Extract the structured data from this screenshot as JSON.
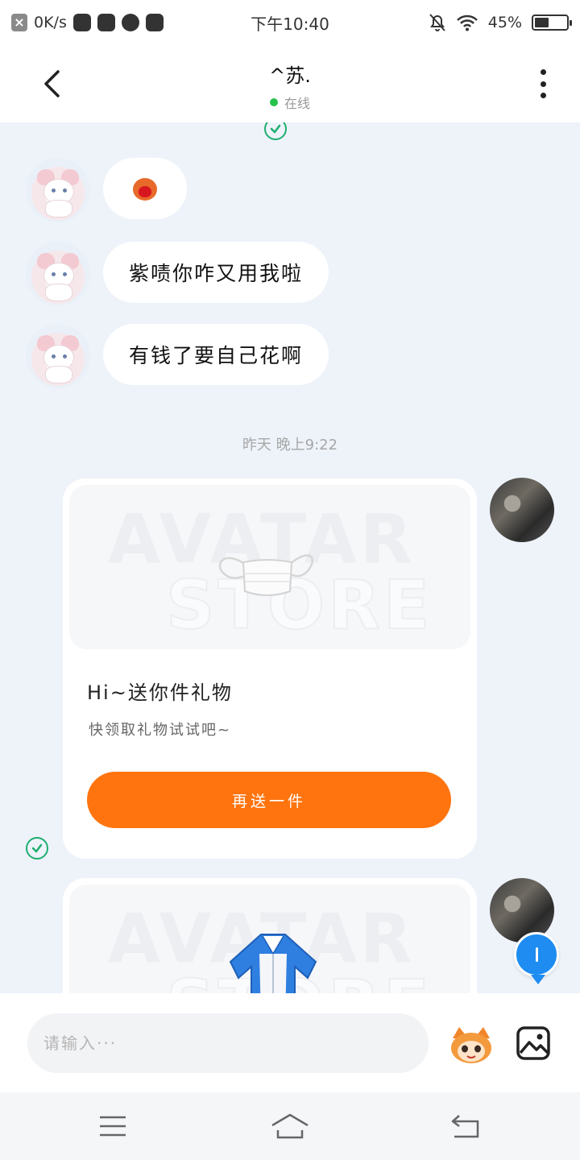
{
  "status_bar": {
    "network_speed": "0K/s",
    "time": "下午10:40",
    "battery_percent": "45%",
    "battery_level": 0.45
  },
  "header": {
    "contact_name": "^苏.",
    "contact_status": "在线",
    "status_color": "#27c24c"
  },
  "messages": [
    {
      "type": "sticker",
      "sender": "contact",
      "icon": "heart-sticker-icon"
    },
    {
      "type": "text",
      "sender": "contact",
      "text": "紫啧你咋又用我啦"
    },
    {
      "type": "text",
      "sender": "contact",
      "text": "有钱了要自己花啊"
    }
  ],
  "time_divider": "昨天 晚上9:22",
  "gift_card": {
    "watermark_line1": "AVATAR",
    "watermark_line2": "STORE",
    "item_icon": "face-mask-icon",
    "title": "Hi~送你件礼物",
    "subtitle": "快领取礼物试试吧~",
    "button_label": "再送一件",
    "button_color": "#ff740e"
  },
  "gift_card_2": {
    "watermark_line1": "AVATAR",
    "watermark_line2": "STORE",
    "item_icon": "jacket-icon"
  },
  "input_bar": {
    "placeholder": "请输入···"
  },
  "colors": {
    "chat_background": "#eef3fa",
    "accent_blue": "#1e8cf0",
    "read_tick": "#1fae6f"
  }
}
